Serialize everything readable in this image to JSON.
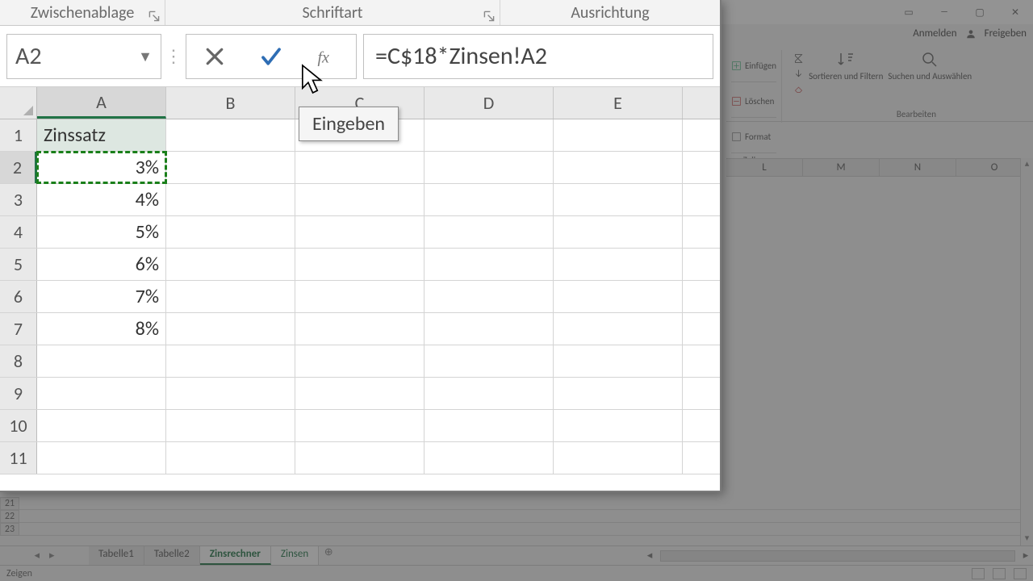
{
  "ribbon_groups": {
    "clipboard": "Zwischenablage",
    "font": "Schriftart",
    "alignment": "Ausrichtung"
  },
  "top_right": {
    "signin": "Anmelden",
    "share": "Freigeben"
  },
  "ribbon_right": {
    "cells": {
      "insert": "Einfügen",
      "delete": "Löschen",
      "format": "Format",
      "label": "Zellen"
    },
    "editing": {
      "sort": "Sortieren und Filtern",
      "find": "Suchen und Auswählen",
      "label": "Bearbeiten"
    }
  },
  "formula_bar": {
    "name_box": "A2",
    "formula": "=C$18*Zinsen!A2",
    "tooltip": "Eingeben"
  },
  "columns": [
    "A",
    "B",
    "C",
    "D",
    "E"
  ],
  "bg_columns": [
    "L",
    "M",
    "N",
    "O"
  ],
  "rows": [
    {
      "n": 1,
      "A": "Zinssatz"
    },
    {
      "n": 2,
      "A": "3%"
    },
    {
      "n": 3,
      "A": "4%"
    },
    {
      "n": 4,
      "A": "5%"
    },
    {
      "n": 5,
      "A": "6%"
    },
    {
      "n": 6,
      "A": "7%"
    },
    {
      "n": 7,
      "A": "8%"
    },
    {
      "n": 8,
      "A": ""
    },
    {
      "n": 9,
      "A": ""
    },
    {
      "n": 10,
      "A": ""
    },
    {
      "n": 11,
      "A": ""
    }
  ],
  "bg_row_nums": [
    21,
    22,
    23
  ],
  "sheet_tabs": {
    "tabs": [
      "Tabelle1",
      "Tabelle2",
      "Zinsrechner",
      "Zinsen"
    ],
    "active": "Zinsrechner"
  },
  "status": "Zeigen"
}
